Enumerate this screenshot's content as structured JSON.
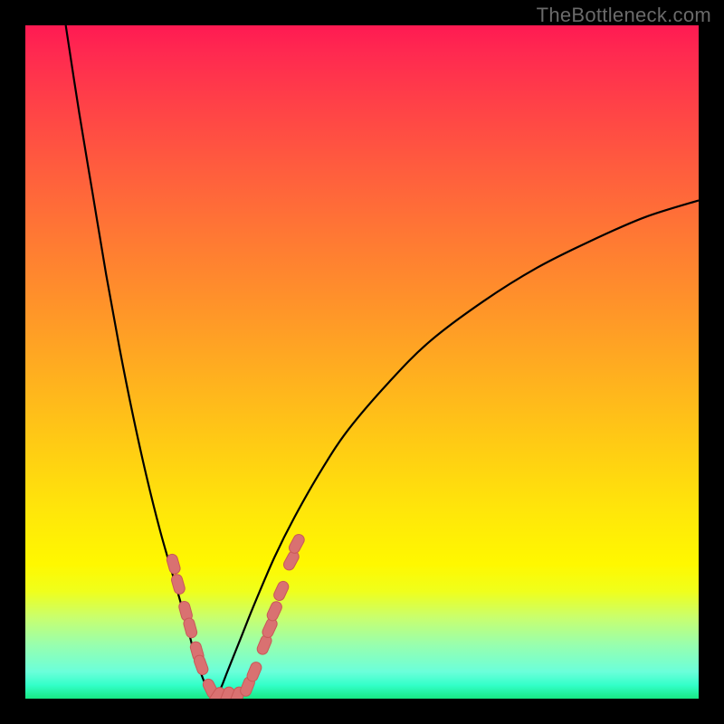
{
  "watermark": "TheBottleneck.com",
  "colors": {
    "frame": "#000000",
    "curve": "#000000",
    "marker_fill": "#d97171",
    "marker_stroke": "#c95858"
  },
  "chart_data": {
    "type": "line",
    "title": "",
    "xlabel": "",
    "ylabel": "",
    "xlim": [
      0,
      100
    ],
    "ylim": [
      0,
      100
    ],
    "note": "V-shaped bottleneck curve; minimum (0) around x≈28. Values are percentage-of-height readings from the figure (0=bottom/green, 100=top/red).",
    "series": [
      {
        "name": "left-branch",
        "x": [
          6,
          8,
          10,
          12,
          14,
          16,
          18,
          20,
          22,
          24,
          25,
          26,
          27,
          28
        ],
        "y": [
          100,
          87,
          75,
          63,
          52,
          42,
          33,
          25,
          18,
          11,
          7,
          4,
          1.5,
          0
        ]
      },
      {
        "name": "right-branch",
        "x": [
          28,
          29,
          30,
          32,
          34,
          37,
          40,
          44,
          48,
          54,
          60,
          68,
          76,
          84,
          92,
          100
        ],
        "y": [
          0,
          1.5,
          4,
          9,
          14,
          21,
          27,
          34,
          40,
          47,
          53,
          59,
          64,
          68,
          71.5,
          74
        ]
      }
    ],
    "markers": {
      "name": "highlighted-points",
      "note": "Salmon pill-shaped markers clustered near the trough on both branches.",
      "points": [
        {
          "x": 22.0,
          "y": 20.0
        },
        {
          "x": 22.7,
          "y": 17.0
        },
        {
          "x": 23.8,
          "y": 13.0
        },
        {
          "x": 24.5,
          "y": 10.5
        },
        {
          "x": 25.5,
          "y": 7.0
        },
        {
          "x": 26.1,
          "y": 5.0
        },
        {
          "x": 27.5,
          "y": 1.5
        },
        {
          "x": 28.5,
          "y": 0.3
        },
        {
          "x": 30.0,
          "y": 0.3
        },
        {
          "x": 31.5,
          "y": 0.3
        },
        {
          "x": 33.0,
          "y": 1.8
        },
        {
          "x": 34.0,
          "y": 4.0
        },
        {
          "x": 35.5,
          "y": 8.0
        },
        {
          "x": 36.3,
          "y": 10.5
        },
        {
          "x": 37.0,
          "y": 13.0
        },
        {
          "x": 38.0,
          "y": 16.0
        },
        {
          "x": 39.5,
          "y": 20.5
        },
        {
          "x": 40.3,
          "y": 23.0
        }
      ]
    }
  }
}
